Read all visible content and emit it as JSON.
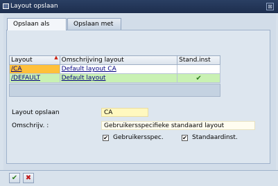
{
  "window": {
    "title": "Layout opslaan",
    "close_symbol": "⊠"
  },
  "tabs": [
    {
      "label": "Opslaan als",
      "active": true
    },
    {
      "label": "Opslaan met",
      "active": false
    }
  ],
  "table": {
    "columns": [
      "Layout",
      "Omschrijving layout",
      "Stand.inst"
    ],
    "rows": [
      {
        "layout": "/CA",
        "description": "Default layout CA",
        "standard": ""
      },
      {
        "layout": "/DEFAULT",
        "description": "Default layout",
        "standard": "✔"
      }
    ]
  },
  "form": {
    "layout_label": "Layout opslaan",
    "layout_value": "CA",
    "desc_label": "Omschrijv. :",
    "desc_value": "Gebruikersspecifieke standaard layout",
    "user_spec_label": "Gebruikersspec.",
    "user_spec_checked": "✔",
    "default_label": "Standaardinst.",
    "default_checked": "✔"
  },
  "buttons": {
    "confirm_symbol": "✔",
    "cancel_symbol": "✖"
  },
  "colors": {
    "title_bar": "#1d2e4e",
    "selected_cell": "#ffc03a",
    "default_row": "#c9f1b3",
    "checkmark": "#2e7d1e",
    "cancel": "#c0191b"
  }
}
